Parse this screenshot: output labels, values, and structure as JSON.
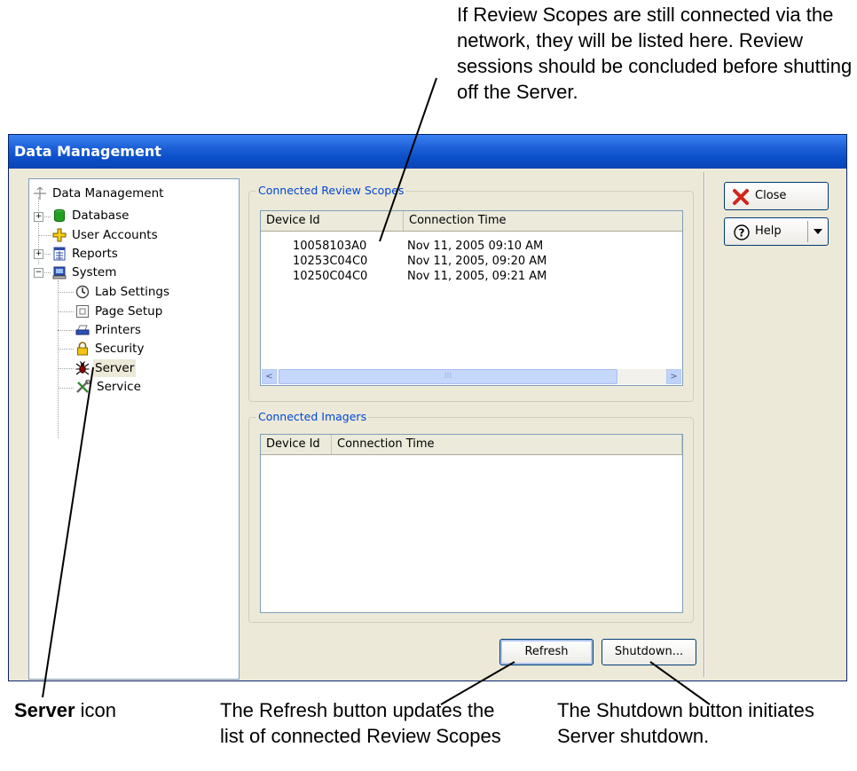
{
  "annotations": {
    "top": "If Review Scopes are still connected via the network, they will be listed here. Review sessions should be concluded before shutting off the Server.",
    "server_bold": "Server",
    "server_rest": " icon",
    "refresh": "The Refresh button updates the list of connected Review Scopes",
    "shutdown": "The Shutdown button initiates Server shutdown."
  },
  "window": {
    "title": "Data Management"
  },
  "tree": {
    "root": "Data Management",
    "items": {
      "database": "Database",
      "user_accounts": "User Accounts",
      "reports": "Reports",
      "system": "System",
      "lab_settings": "Lab Settings",
      "page_setup": "Page Setup",
      "printers": "Printers",
      "security": "Security",
      "server": "Server",
      "service": "Service"
    },
    "expanders": {
      "collapsed": "+",
      "expanded": "−"
    }
  },
  "scopes": {
    "title": "Connected Review Scopes",
    "columns": [
      "Device Id",
      "Connection Time"
    ],
    "rows": [
      [
        "10058103A0",
        "Nov 11, 2005  09:10 AM"
      ],
      [
        "10253C04C0",
        "Nov 11, 2005, 09:20 AM"
      ],
      [
        "10250C04C0",
        "Nov 11, 2005,  09:21 AM"
      ]
    ],
    "scroll_left": "<",
    "scroll_right": ">",
    "scroll_grip": "III"
  },
  "imagers": {
    "title": "Connected Imagers",
    "columns": [
      "Device Id",
      "Connection Time"
    ]
  },
  "buttons": {
    "refresh": "Refresh",
    "shutdown": "Shutdown...",
    "close": "Close",
    "help": "Help"
  },
  "colors": {
    "title_bar": "#0A4EC8",
    "window_bg": "#ECE9D8",
    "group_label": "#0046D5",
    "close_x": "#D0261C"
  }
}
